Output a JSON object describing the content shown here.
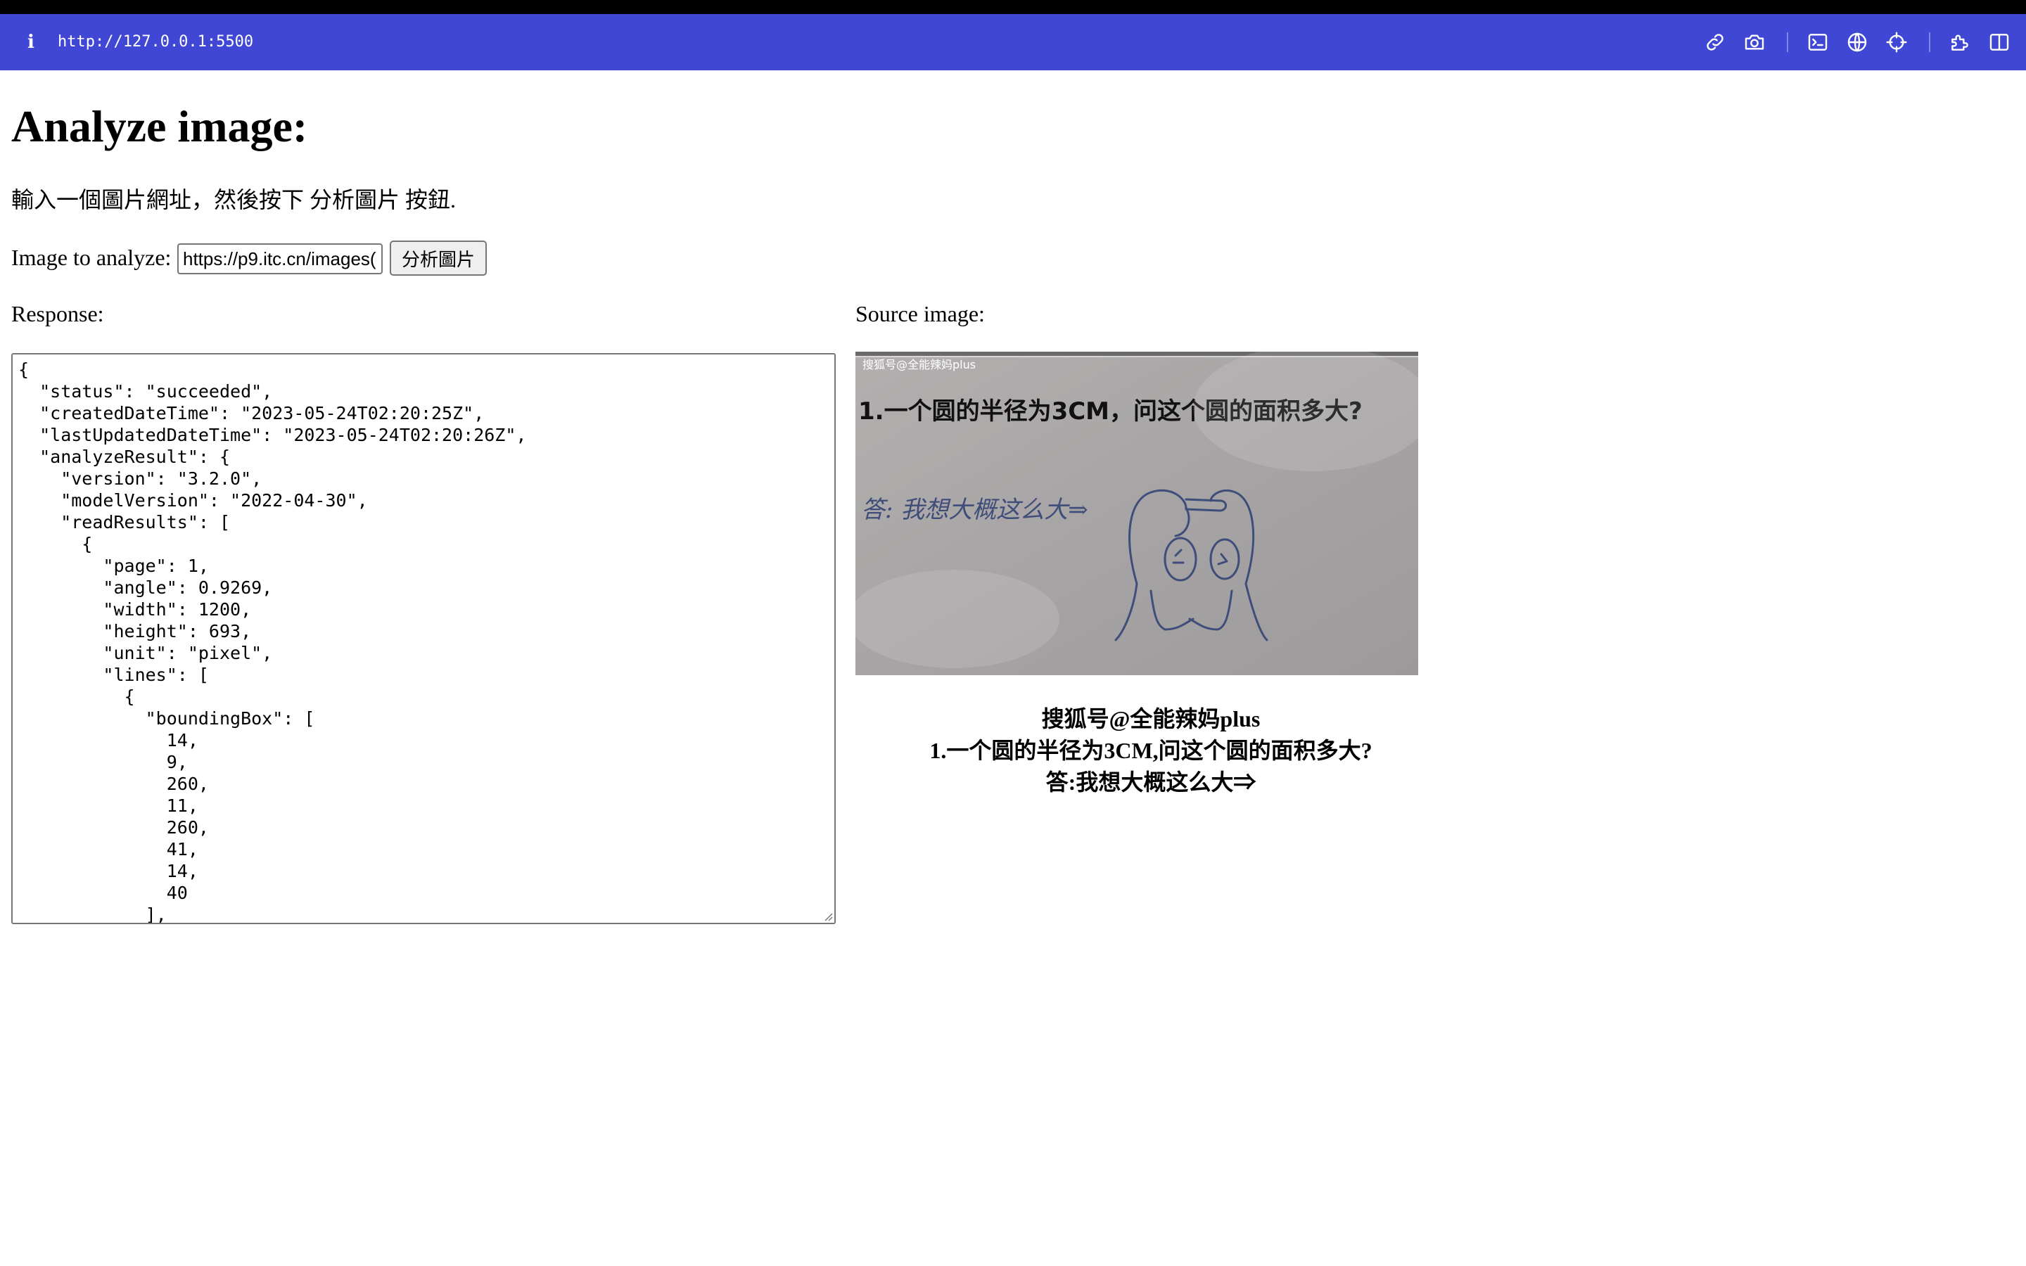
{
  "browser": {
    "url": "http://127.0.0.1:5500",
    "info_glyph": "i",
    "toolbar_icons": [
      "link-icon",
      "camera-icon",
      "terminal-icon",
      "globe-icon",
      "crosshair-icon",
      "extensions-icon",
      "sidebar-icon"
    ]
  },
  "page": {
    "title": "Analyze image:",
    "instruction": "輸入一個圖片網址，然後按下 分析圖片 按鈕.",
    "input_label": "Image to analyze:",
    "input_value": "https://p9.itc.cn/images(",
    "button_label": "分析圖片",
    "response_label": "Response:",
    "source_label": "Source image:",
    "response_text": "{\n  \"status\": \"succeeded\",\n  \"createdDateTime\": \"2023-05-24T02:20:25Z\",\n  \"lastUpdatedDateTime\": \"2023-05-24T02:20:26Z\",\n  \"analyzeResult\": {\n    \"version\": \"3.2.0\",\n    \"modelVersion\": \"2022-04-30\",\n    \"readResults\": [\n      {\n        \"page\": 1,\n        \"angle\": 0.9269,\n        \"width\": 1200,\n        \"height\": 693,\n        \"unit\": \"pixel\",\n        \"lines\": [\n          {\n            \"boundingBox\": [\n              14,\n              9,\n              260,\n              11,\n              260,\n              41,\n              14,\n              40\n            ],",
    "ocr_lines": [
      "搜狐号@全能辣妈plus",
      "1.一个圆的半径为3CM,问这个圆的面积多大?",
      "答:我想大概这么大⇒"
    ]
  },
  "source_image": {
    "watermark": "搜狐号@全能辣妈plus",
    "question": "1.一个圆的半径为3CM，问这个圆的面积多大?",
    "answer": "答: 我想大概这么大⇒"
  },
  "colors": {
    "browser_bar": "#4147d5",
    "paper": "#a9a6a6",
    "pencil": "#3f4d7a"
  }
}
